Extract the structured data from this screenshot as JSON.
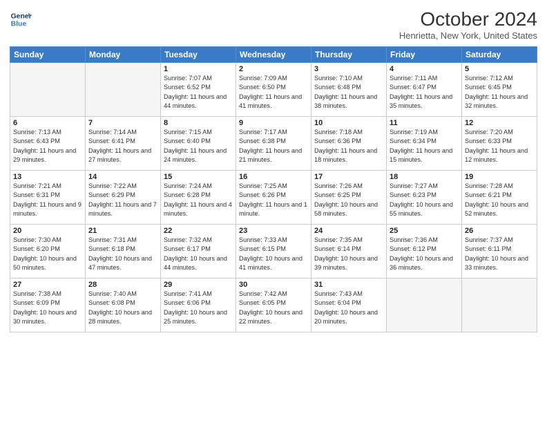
{
  "header": {
    "logo": {
      "line1": "General",
      "line2": "Blue"
    },
    "title": "October 2024",
    "subtitle": "Henrietta, New York, United States"
  },
  "days_of_week": [
    "Sunday",
    "Monday",
    "Tuesday",
    "Wednesday",
    "Thursday",
    "Friday",
    "Saturday"
  ],
  "weeks": [
    [
      {
        "day": "",
        "empty": true
      },
      {
        "day": "",
        "empty": true
      },
      {
        "day": "1",
        "sunrise": "Sunrise: 7:07 AM",
        "sunset": "Sunset: 6:52 PM",
        "daylight": "Daylight: 11 hours and 44 minutes."
      },
      {
        "day": "2",
        "sunrise": "Sunrise: 7:09 AM",
        "sunset": "Sunset: 6:50 PM",
        "daylight": "Daylight: 11 hours and 41 minutes."
      },
      {
        "day": "3",
        "sunrise": "Sunrise: 7:10 AM",
        "sunset": "Sunset: 6:48 PM",
        "daylight": "Daylight: 11 hours and 38 minutes."
      },
      {
        "day": "4",
        "sunrise": "Sunrise: 7:11 AM",
        "sunset": "Sunset: 6:47 PM",
        "daylight": "Daylight: 11 hours and 35 minutes."
      },
      {
        "day": "5",
        "sunrise": "Sunrise: 7:12 AM",
        "sunset": "Sunset: 6:45 PM",
        "daylight": "Daylight: 11 hours and 32 minutes."
      }
    ],
    [
      {
        "day": "6",
        "sunrise": "Sunrise: 7:13 AM",
        "sunset": "Sunset: 6:43 PM",
        "daylight": "Daylight: 11 hours and 29 minutes."
      },
      {
        "day": "7",
        "sunrise": "Sunrise: 7:14 AM",
        "sunset": "Sunset: 6:41 PM",
        "daylight": "Daylight: 11 hours and 27 minutes."
      },
      {
        "day": "8",
        "sunrise": "Sunrise: 7:15 AM",
        "sunset": "Sunset: 6:40 PM",
        "daylight": "Daylight: 11 hours and 24 minutes."
      },
      {
        "day": "9",
        "sunrise": "Sunrise: 7:17 AM",
        "sunset": "Sunset: 6:38 PM",
        "daylight": "Daylight: 11 hours and 21 minutes."
      },
      {
        "day": "10",
        "sunrise": "Sunrise: 7:18 AM",
        "sunset": "Sunset: 6:36 PM",
        "daylight": "Daylight: 11 hours and 18 minutes."
      },
      {
        "day": "11",
        "sunrise": "Sunrise: 7:19 AM",
        "sunset": "Sunset: 6:34 PM",
        "daylight": "Daylight: 11 hours and 15 minutes."
      },
      {
        "day": "12",
        "sunrise": "Sunrise: 7:20 AM",
        "sunset": "Sunset: 6:33 PM",
        "daylight": "Daylight: 11 hours and 12 minutes."
      }
    ],
    [
      {
        "day": "13",
        "sunrise": "Sunrise: 7:21 AM",
        "sunset": "Sunset: 6:31 PM",
        "daylight": "Daylight: 11 hours and 9 minutes."
      },
      {
        "day": "14",
        "sunrise": "Sunrise: 7:22 AM",
        "sunset": "Sunset: 6:29 PM",
        "daylight": "Daylight: 11 hours and 7 minutes."
      },
      {
        "day": "15",
        "sunrise": "Sunrise: 7:24 AM",
        "sunset": "Sunset: 6:28 PM",
        "daylight": "Daylight: 11 hours and 4 minutes."
      },
      {
        "day": "16",
        "sunrise": "Sunrise: 7:25 AM",
        "sunset": "Sunset: 6:26 PM",
        "daylight": "Daylight: 11 hours and 1 minute."
      },
      {
        "day": "17",
        "sunrise": "Sunrise: 7:26 AM",
        "sunset": "Sunset: 6:25 PM",
        "daylight": "Daylight: 10 hours and 58 minutes."
      },
      {
        "day": "18",
        "sunrise": "Sunrise: 7:27 AM",
        "sunset": "Sunset: 6:23 PM",
        "daylight": "Daylight: 10 hours and 55 minutes."
      },
      {
        "day": "19",
        "sunrise": "Sunrise: 7:28 AM",
        "sunset": "Sunset: 6:21 PM",
        "daylight": "Daylight: 10 hours and 52 minutes."
      }
    ],
    [
      {
        "day": "20",
        "sunrise": "Sunrise: 7:30 AM",
        "sunset": "Sunset: 6:20 PM",
        "daylight": "Daylight: 10 hours and 50 minutes."
      },
      {
        "day": "21",
        "sunrise": "Sunrise: 7:31 AM",
        "sunset": "Sunset: 6:18 PM",
        "daylight": "Daylight: 10 hours and 47 minutes."
      },
      {
        "day": "22",
        "sunrise": "Sunrise: 7:32 AM",
        "sunset": "Sunset: 6:17 PM",
        "daylight": "Daylight: 10 hours and 44 minutes."
      },
      {
        "day": "23",
        "sunrise": "Sunrise: 7:33 AM",
        "sunset": "Sunset: 6:15 PM",
        "daylight": "Daylight: 10 hours and 41 minutes."
      },
      {
        "day": "24",
        "sunrise": "Sunrise: 7:35 AM",
        "sunset": "Sunset: 6:14 PM",
        "daylight": "Daylight: 10 hours and 39 minutes."
      },
      {
        "day": "25",
        "sunrise": "Sunrise: 7:36 AM",
        "sunset": "Sunset: 6:12 PM",
        "daylight": "Daylight: 10 hours and 36 minutes."
      },
      {
        "day": "26",
        "sunrise": "Sunrise: 7:37 AM",
        "sunset": "Sunset: 6:11 PM",
        "daylight": "Daylight: 10 hours and 33 minutes."
      }
    ],
    [
      {
        "day": "27",
        "sunrise": "Sunrise: 7:38 AM",
        "sunset": "Sunset: 6:09 PM",
        "daylight": "Daylight: 10 hours and 30 minutes."
      },
      {
        "day": "28",
        "sunrise": "Sunrise: 7:40 AM",
        "sunset": "Sunset: 6:08 PM",
        "daylight": "Daylight: 10 hours and 28 minutes."
      },
      {
        "day": "29",
        "sunrise": "Sunrise: 7:41 AM",
        "sunset": "Sunset: 6:06 PM",
        "daylight": "Daylight: 10 hours and 25 minutes."
      },
      {
        "day": "30",
        "sunrise": "Sunrise: 7:42 AM",
        "sunset": "Sunset: 6:05 PM",
        "daylight": "Daylight: 10 hours and 22 minutes."
      },
      {
        "day": "31",
        "sunrise": "Sunrise: 7:43 AM",
        "sunset": "Sunset: 6:04 PM",
        "daylight": "Daylight: 10 hours and 20 minutes."
      },
      {
        "day": "",
        "empty": true
      },
      {
        "day": "",
        "empty": true
      }
    ]
  ]
}
